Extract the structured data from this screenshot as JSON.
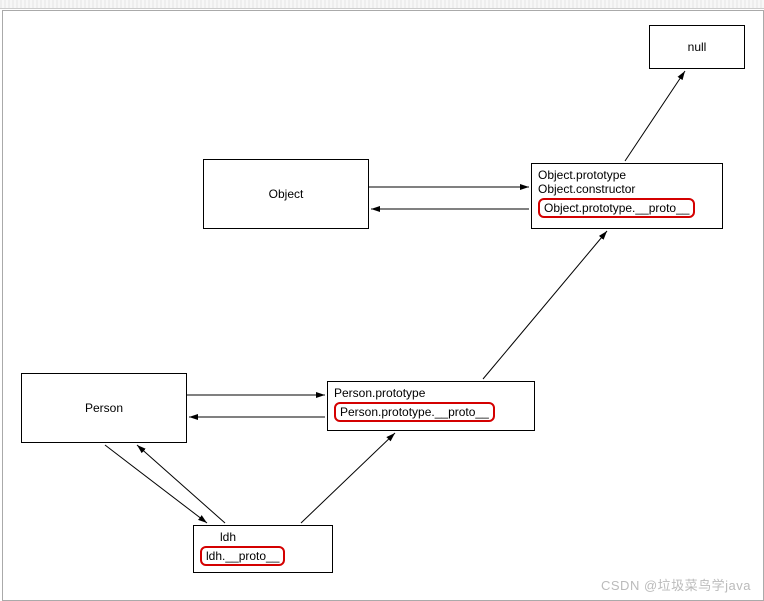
{
  "nodes": {
    "null": {
      "label": "null"
    },
    "object": {
      "label": "Object"
    },
    "objectProto": {
      "line1": "Object.prototype",
      "line2": "Object.constructor",
      "highlight": "Object.prototype.__proto__"
    },
    "person": {
      "label": "Person"
    },
    "personProto": {
      "line1": "Person.prototype",
      "highlight": "Person.prototype.__proto__"
    },
    "ldh": {
      "line1": "ldh",
      "highlight": "ldh.__proto__"
    }
  },
  "watermark": "CSDN @垃圾菜鸟学java"
}
